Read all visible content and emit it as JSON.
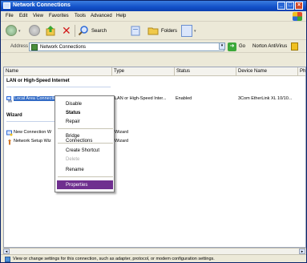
{
  "window": {
    "title": "Network Connections"
  },
  "menubar": [
    "File",
    "Edit",
    "View",
    "Favorites",
    "Tools",
    "Advanced",
    "Help"
  ],
  "toolbar": {
    "search_label": "Search",
    "folders_label": "Folders"
  },
  "address": {
    "label": "Address",
    "value": "Network Connections",
    "go_label": "Go",
    "norton_label": "Norton AntiVirus"
  },
  "columns": [
    "Name",
    "Type",
    "Status",
    "Device Name",
    "Pho"
  ],
  "groups": [
    {
      "title": "LAN or High-Speed Internet",
      "rows": [
        {
          "name": "Local Area Connection",
          "type": "LAN or High-Speed Inter...",
          "status": "Enabled",
          "device": "3Com EtherLink XL 10/10..."
        }
      ]
    },
    {
      "title": "Wizard",
      "rows": [
        {
          "name": "New Connection W",
          "type": "Wizard"
        },
        {
          "name": "Network Setup Wiz",
          "type": "Wizard"
        }
      ]
    }
  ],
  "context_menu": [
    {
      "label": "Disable",
      "style": "normal"
    },
    {
      "label": "Status",
      "style": "bold"
    },
    {
      "label": "Repair",
      "style": "normal"
    },
    {
      "label": "Bridge Connections",
      "style": "normal"
    },
    {
      "label": "Create Shortcut",
      "style": "normal"
    },
    {
      "label": "Delete",
      "style": "disabled"
    },
    {
      "label": "Rename",
      "style": "normal"
    },
    {
      "label": "Properties",
      "style": "highlighted"
    }
  ],
  "statusbar": {
    "text": "View or change settings for this connection, such as adapter, protocol, or modem configuration settings."
  },
  "colors": {
    "selection": "#316ac5",
    "menu_highlight": "#6f2f8f",
    "titlebar": "#1250c8"
  }
}
